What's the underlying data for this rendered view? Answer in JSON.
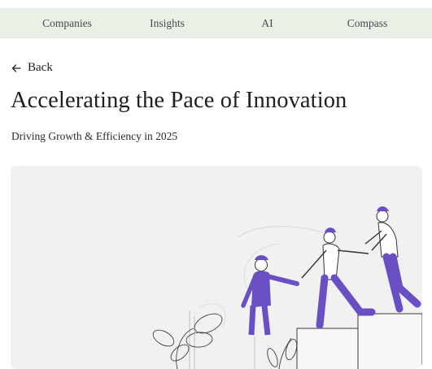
{
  "nav": {
    "items": [
      {
        "label": "Companies"
      },
      {
        "label": "Insights"
      },
      {
        "label": "AI"
      },
      {
        "label": "Compass"
      }
    ]
  },
  "back": {
    "label": "Back",
    "icon": "arrow-left-icon"
  },
  "article": {
    "title": "Accelerating the Pace of Innovation",
    "subtitle": "Driving Growth & Efficiency in 2025"
  },
  "hero": {
    "illustration": "people-helping-climb-steps",
    "background_color": "#f1f1f1",
    "accent_color": "#6a4fc4"
  }
}
